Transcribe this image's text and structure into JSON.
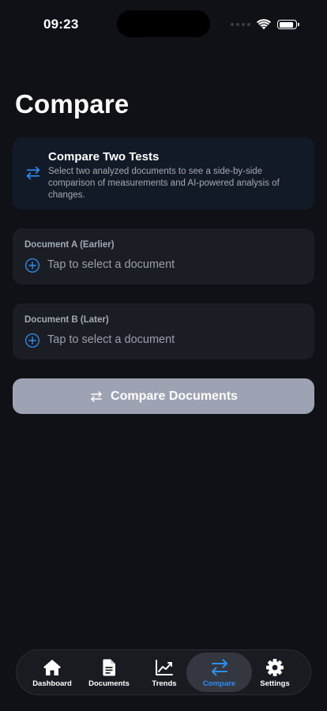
{
  "status_bar": {
    "time": "09:23",
    "battery_level": 0.9
  },
  "page": {
    "title": "Compare"
  },
  "info_card": {
    "icon": "arrows-exchange-icon",
    "title": "Compare Two Tests",
    "description": "Select two analyzed documents to see a side-by-side comparison of measurements and AI-powered analysis of changes."
  },
  "document_a": {
    "label": "Document A (Earlier)",
    "placeholder": "Tap to select a document"
  },
  "document_b": {
    "label": "Document B (Later)",
    "placeholder": "Tap to select a document"
  },
  "compare_button": {
    "label": "Compare Documents"
  },
  "tab_bar": {
    "tabs": [
      {
        "label": "Dashboard",
        "icon": "house-icon"
      },
      {
        "label": "Documents",
        "icon": "document-icon"
      },
      {
        "label": "Trends",
        "icon": "chart-line-icon"
      },
      {
        "label": "Compare",
        "icon": "arrows-exchange-icon"
      },
      {
        "label": "Settings",
        "icon": "gear-icon"
      }
    ],
    "active": "Compare"
  },
  "colors": {
    "background": "#0f1116",
    "accent": "#2e8ef5",
    "card": "#1b1d24",
    "info_card": "#131a27",
    "button_disabled": "#9ea3b3"
  }
}
